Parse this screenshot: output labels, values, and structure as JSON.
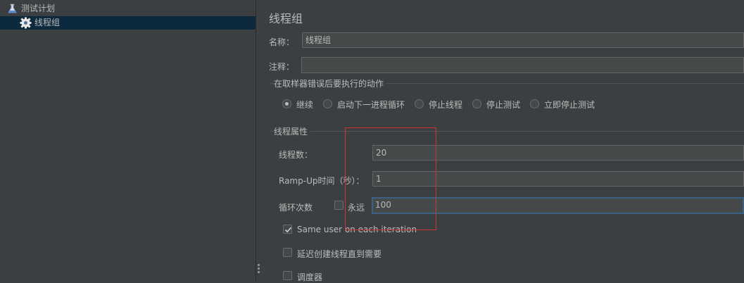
{
  "tree": {
    "items": [
      {
        "label": "测试计划",
        "icon": "flask-icon"
      },
      {
        "label": "线程组",
        "icon": "gear-icon"
      }
    ]
  },
  "panel": {
    "title": "线程组",
    "name_label": "名称：",
    "name_value": "线程组",
    "comment_label": "注释：",
    "comment_value": "",
    "error_group": {
      "title": "在取样器错误后要执行的动作",
      "options": [
        "继续",
        "启动下一进程循环",
        "停止线程",
        "停止测试",
        "立即停止测试"
      ],
      "selected": "继续"
    },
    "thread_group": {
      "title": "线程属性",
      "threads_label": "线程数：",
      "threads_value": "20",
      "rampup_label": "Ramp-Up时间（秒）：",
      "rampup_value": "1",
      "loop_label": "循环次数",
      "forever_label": "永远",
      "forever_checked": false,
      "loop_value": "100",
      "same_user_label": "Same user on each iteration",
      "same_user_checked": true,
      "delay_label": "延迟创建线程直到需要",
      "delay_checked": false,
      "scheduler_label": "调度器",
      "scheduler_checked": false
    }
  },
  "colors": {
    "background": "#3c3f41",
    "selection": "#0d293e",
    "field": "#45494a",
    "focus_border": "#3d6185",
    "annotation_box": "#d23232"
  }
}
